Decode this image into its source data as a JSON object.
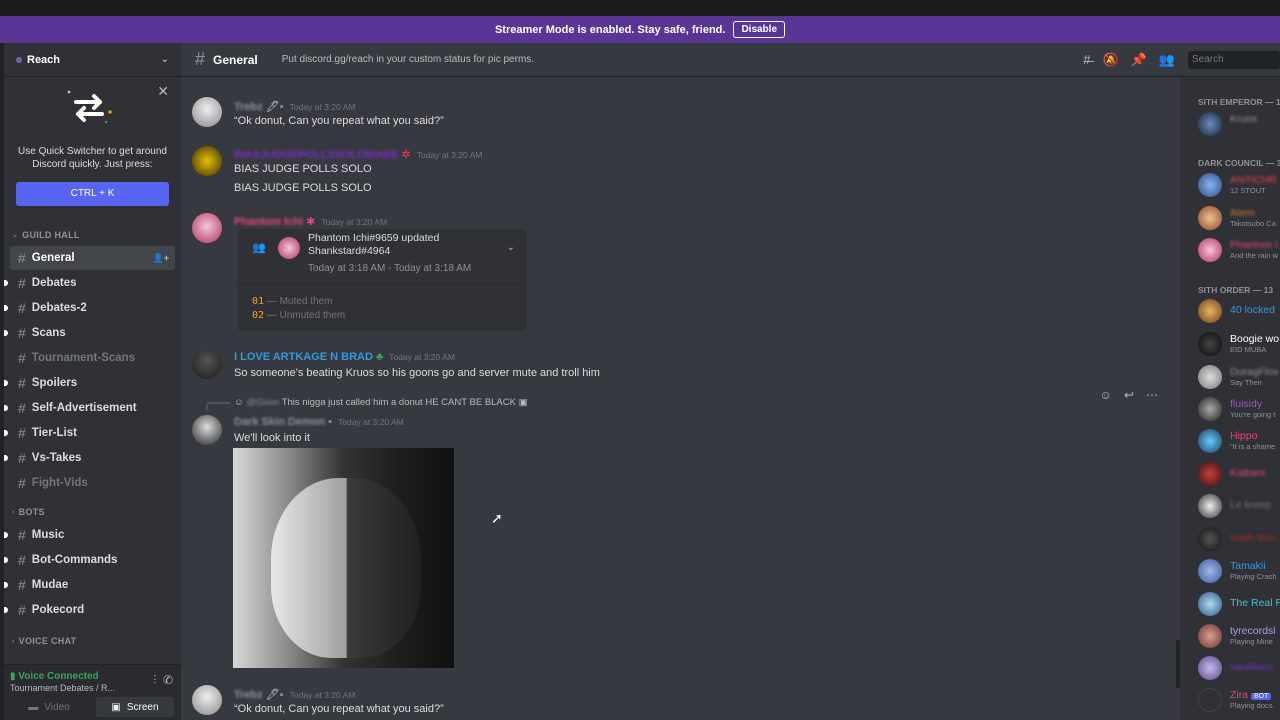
{
  "banner": {
    "text": "Streamer Mode is enabled. Stay safe, friend.",
    "button": "Disable"
  },
  "guild": {
    "name": "Reach"
  },
  "quick_switcher": {
    "text": "Use Quick Switcher to get around Discord quickly. Just press:",
    "shortcut": "CTRL + K"
  },
  "sidebar": {
    "categories": [
      {
        "name": "GUILD HALL"
      },
      {
        "name": "BOTS"
      },
      {
        "name": "VOICE CHAT"
      }
    ],
    "guild_hall_channels": [
      "General",
      "Debates",
      "Debates-2",
      "Scans",
      "Tournament-Scans",
      "Spoilers",
      "Self-Advertisement",
      "Tier-List",
      "Vs-Takes",
      "Fight-Vids"
    ],
    "bot_channels": [
      "Music",
      "Bot-Commands",
      "Mudae",
      "Pokecord"
    ]
  },
  "voice": {
    "status": "Voice Connected",
    "sub": "Tournament Debates / R...",
    "video": "Video",
    "screen": "Screen"
  },
  "header": {
    "channel": "General",
    "topic": "Put discord.gg/reach in your custom status for pic perms.",
    "search_placeholder": "Search"
  },
  "messages": [
    {
      "user": "Trebz",
      "time": "Today at 3:20 AM",
      "lines": [
        "“Ok donut, Can you repeat what you said?”"
      ]
    },
    {
      "user": "BIASJUDGEPOLLSSOLOMABE",
      "time": "Today at 3:20 AM",
      "lines": [
        "BIAS JUDGE POLLS SOLO",
        "BIAS JUDGE POLLS SOLO"
      ]
    },
    {
      "user": "Phantom Ichi",
      "time": "Today at 3:20 AM",
      "lines": []
    },
    {
      "user": "I LOVE ARTKAGE N BRAD",
      "time": "Today at 3:20 AM",
      "lines": [
        "So someone's beating Kruos so his goons go and server mute and troll him"
      ]
    },
    {
      "user": "Dark Skin Demon",
      "time": "Today at 3:20 AM",
      "lines": [
        "We'll look into it"
      ],
      "reply_user": "@Goon",
      "reply_text": "This nigga just called him a donut HE CANT BE BLACK"
    },
    {
      "user": "Trebz",
      "time": "Today at 3:20 AM",
      "lines": [
        "“Ok donut, Can you repeat what you said?”"
      ]
    }
  ],
  "audit_embed": {
    "title": "Phantom Ichi#9659 updated Shankstard#4964",
    "time": "Today at 3:18 AM - Today at 3:18 AM",
    "entries": [
      {
        "num": "01",
        "text": "— Muted them"
      },
      {
        "num": "02",
        "text": "— Unmuted them"
      }
    ]
  },
  "members": {
    "categories": [
      {
        "name": "SITH EMPEROR — 1"
      },
      {
        "name": "DARK COUNCIL — 3"
      },
      {
        "name": "SITH ORDER — 13"
      }
    ],
    "list": [
      {
        "name": "Kruos",
        "status": "",
        "color": "#8e9297"
      },
      {
        "name": "ANTICHR",
        "status": "12 STOUT",
        "color": "#ed4245"
      },
      {
        "name": "Atem",
        "status": "Takotsubo Ca",
        "color": "#c9792e"
      },
      {
        "name": "Phantom I",
        "status": "And the rain w",
        "color": "#e0467c"
      },
      {
        "name": "40 locked",
        "status": "",
        "color": "#3498db"
      },
      {
        "name": "Boogie wo",
        "status": "EID MUBA",
        "color": "#ffffff"
      },
      {
        "name": "DuragFlov",
        "status": "Say Their",
        "color": "#8e9297"
      },
      {
        "name": "fluisidy",
        "status": "You're going t",
        "color": "#9b59b6"
      },
      {
        "name": "Hippo",
        "status": "\"It is a shame",
        "color": "#e0467c"
      },
      {
        "name": "Kaibani",
        "status": "",
        "color": "#e0467c"
      },
      {
        "name": "Le kreep",
        "status": "",
        "color": "#72767d"
      },
      {
        "name": "Nash Blac",
        "status": "",
        "color": "#992d22"
      },
      {
        "name": "Tamakii",
        "status": "Playing Crash",
        "color": "#3498db"
      },
      {
        "name": "The Real R",
        "status": "",
        "color": "#3ec1d3"
      },
      {
        "name": "tyrecordsl",
        "status": "Playing Mine",
        "color": "#b39ddb"
      },
      {
        "name": "vanillaice",
        "status": "",
        "color": "#7b2fbe"
      },
      {
        "name": "Zira",
        "status": "Playing docs.",
        "color": "#e0467c"
      }
    ],
    "bot_tag": "BOT"
  }
}
